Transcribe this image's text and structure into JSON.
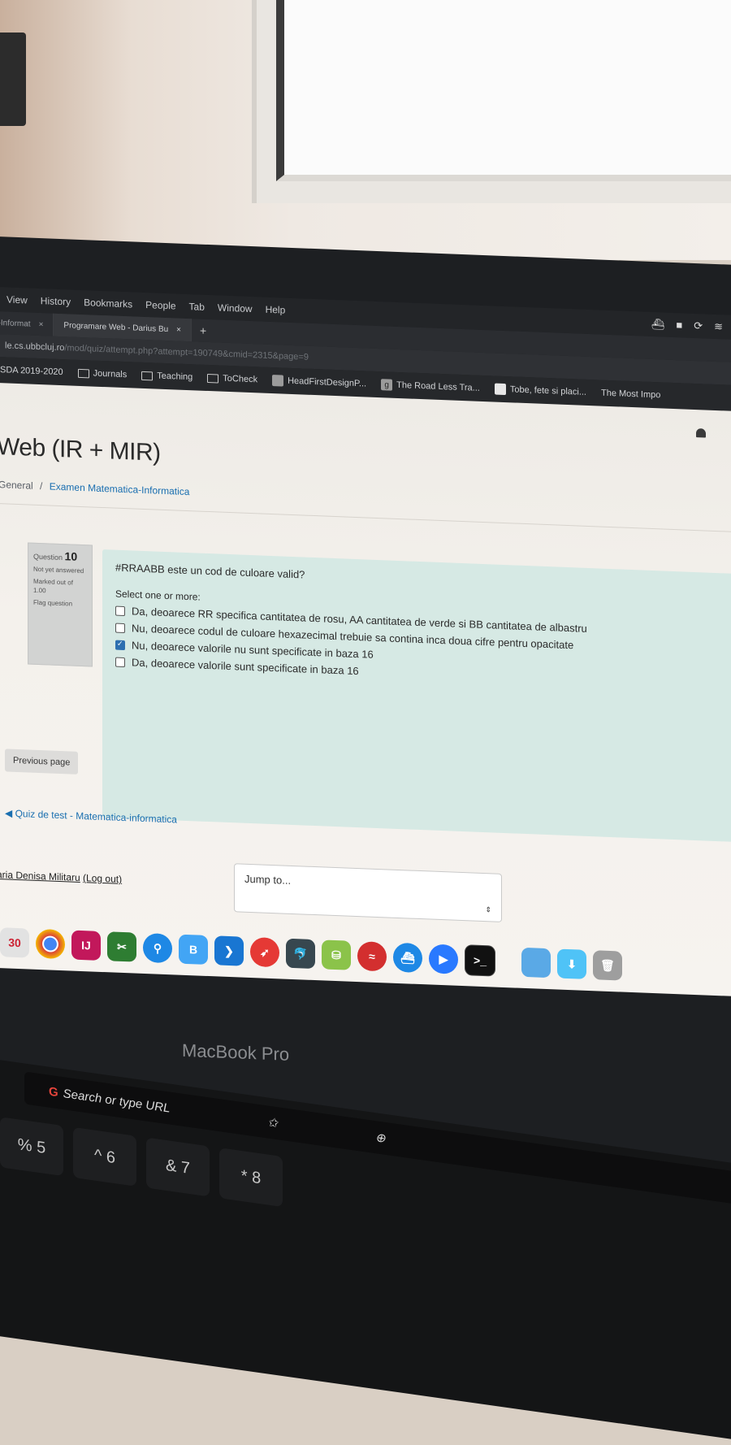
{
  "menubar": {
    "items": [
      "View",
      "History",
      "Bookmarks",
      "People",
      "Tab",
      "Window",
      "Help"
    ]
  },
  "tabs": [
    {
      "label": "tica-Informat",
      "close": "×"
    },
    {
      "label": "Programare Web - Darius Bu",
      "close": "×"
    }
  ],
  "new_tab": "+",
  "address": {
    "host": "le.cs.ubbcluj.ro",
    "path": "/mod/quiz/attempt.php?attempt=190749&cmid=2315&page=9"
  },
  "bookmarks": [
    {
      "label": "SDA 2019-2020",
      "type": "folder"
    },
    {
      "label": "Journals",
      "type": "folder"
    },
    {
      "label": "Teaching",
      "type": "folder"
    },
    {
      "label": "ToCheck",
      "type": "folder"
    },
    {
      "label": "HeadFirstDesignP...",
      "type": "site"
    },
    {
      "label": "The Road Less Tra...",
      "type": "site",
      "favicon": "g"
    },
    {
      "label": "Tobe, fete si placi...",
      "type": "site"
    },
    {
      "label": "The Most Impo",
      "type": "site"
    }
  ],
  "course": {
    "title": "Web (IR + MIR)",
    "breadcrumb_general": "General",
    "breadcrumb_sep": "/",
    "breadcrumb_quiz": "Examen Matematica-Informatica"
  },
  "question_info": {
    "label": "Question",
    "number": "10",
    "state": "Not yet answered",
    "marks": "Marked out of 1.00",
    "flag": "Flag question"
  },
  "question": {
    "text": "#RRAABB este un cod de culoare valid?",
    "hint": "Select one or more:",
    "options": [
      {
        "label": "Da, deoarece RR specifica cantitatea de rosu, AA cantitatea de verde si BB cantitatea de albastru",
        "checked": false
      },
      {
        "label": "Nu, deoarece codul de culoare hexazecimal trebuie sa contina inca doua cifre pentru opacitate",
        "checked": false
      },
      {
        "label": "Nu, deoarece valorile nu sunt specificate in baza 16",
        "checked": true
      },
      {
        "label": "Da, deoarece valorile sunt specificate in baza 16",
        "checked": false
      }
    ]
  },
  "nav": {
    "previous_page": "Previous page",
    "back_link": "◀ Quiz de test - Matematica-informatica",
    "jump_to": "Jump to...",
    "jump_arrows": "⇕"
  },
  "user": {
    "name": "aria Denisa Militaru",
    "logout": "(Log out)"
  },
  "dock": {
    "calendar_day": "30"
  },
  "laptop": {
    "brand": "MacBook Pro"
  },
  "touchbar": {
    "search": "Search or type URL"
  },
  "keys": [
    "%\n5",
    "^\n6",
    "&\n7",
    "*\n8"
  ],
  "colors": {
    "accent_link": "#1a6fb0",
    "question_bg": "#d6e9e4",
    "checkbox_checked": "#2d6fb0"
  }
}
